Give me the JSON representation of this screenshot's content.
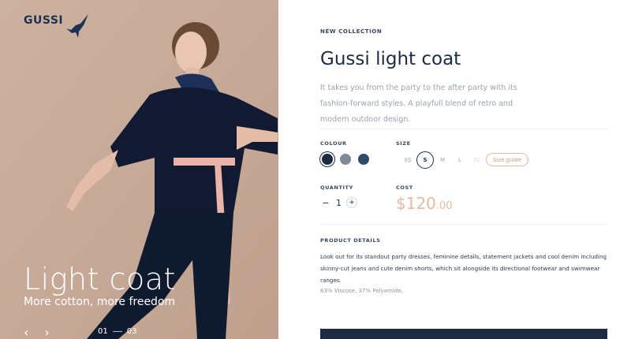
{
  "brand": {
    "name": "GUSSI",
    "icon": "bird-icon"
  },
  "hero": {
    "title": "Light coat",
    "subtitle": "More cotton, more freedom",
    "prev_icon": "‹",
    "next_icon": "›",
    "pager_current": "01",
    "pager_total": "03"
  },
  "product": {
    "eyebrow": "NEW COLLECTION",
    "title": "Gussi light coat",
    "description": "It takes you from the party to the after party with its fashion-forward styles. A playfull blend of retro and modern outdoor design.",
    "colour_label": "COLOUR",
    "colours": [
      "#1c2b3f",
      "#7f8a99",
      "#2e4a6b"
    ],
    "size_label": "SIZE",
    "sizes": [
      "XS",
      "S",
      "M",
      "L",
      "XL"
    ],
    "selected_size": "S",
    "size_guide": "Size guide",
    "quantity_label": "QUANTITY",
    "quantity": "1",
    "minus": "−",
    "plus": "+",
    "cost_label": "COST",
    "price_main": "$120",
    "price_cents": ".00",
    "details_label": "PRODUCT DETAILS",
    "details": "Look out for its standout party dresses, feminine details, statement jackets and cool denim including skinny-cut jeans and cute denim shorts, which sit alongside its directional footwear and swimwear ranges.",
    "materials": "63% Viscose, 37% Polyamide."
  },
  "colors": {
    "accent": "#e5b9a4",
    "navy": "#1c2b3f",
    "hero_bg": "#c8ab99"
  }
}
